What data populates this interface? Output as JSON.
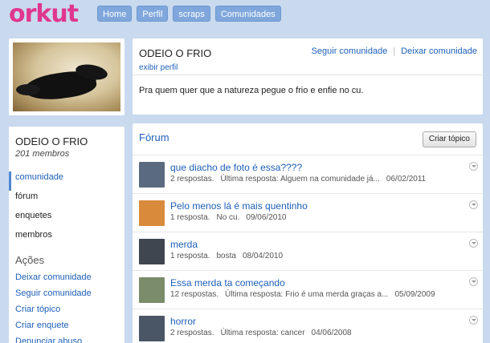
{
  "brand": {
    "logo": "orkut",
    "logo_color": "#e0378e"
  },
  "nav": [
    {
      "label": "Home"
    },
    {
      "label": "Perfil"
    },
    {
      "label": "scraps"
    },
    {
      "label": "Comunidades"
    }
  ],
  "community": {
    "name": "ODEIO O FRIO",
    "follow_link": "Seguir comunidade",
    "leave_link": "Deixar comunidade",
    "profile_link": "exibir perfil",
    "description": "Pra quem quer que a natureza pegue o frio e enfie no cu.",
    "members": "201 membros"
  },
  "sidebar": {
    "items": [
      {
        "label": "comunidade",
        "active": true
      },
      {
        "label": "fórum"
      },
      {
        "label": "enquetes"
      },
      {
        "label": "membros"
      }
    ],
    "actions_title": "Ações",
    "actions": [
      {
        "label": "Deixar comunidade"
      },
      {
        "label": "Seguir comunidade"
      },
      {
        "label": "Criar tópico"
      },
      {
        "label": "Criar enquete"
      },
      {
        "label": "Denunciar abuso"
      }
    ]
  },
  "forum": {
    "title": "Fórum",
    "create_button": "Criar tópico",
    "topics": [
      {
        "title": "que diacho de foto é essa????",
        "replies": "2 respostas.",
        "last": "Última resposta: Alguem na comunidade já...",
        "date": "06/02/2011",
        "avatar_color": "#5a6a80"
      },
      {
        "title": "Pelo menos lá é mais quentinho",
        "replies": "1 resposta.",
        "last": "No cu.",
        "date": "09/06/2010",
        "avatar_color": "#d98a3a"
      },
      {
        "title": "merda",
        "replies": "1 resposta.",
        "last": "bosta",
        "date": "08/04/2010",
        "avatar_color": "#3f4650"
      },
      {
        "title": "Essa merda ta começando",
        "replies": "12 respostas.",
        "last": "Última resposta: Frio é uma merda graças a...",
        "date": "05/09/2009",
        "avatar_color": "#7a8c6a"
      },
      {
        "title": "horror",
        "replies": "2 respostas.",
        "last": "Última resposta: cancer",
        "date": "04/06/2008",
        "avatar_color": "#4a5566"
      }
    ]
  }
}
